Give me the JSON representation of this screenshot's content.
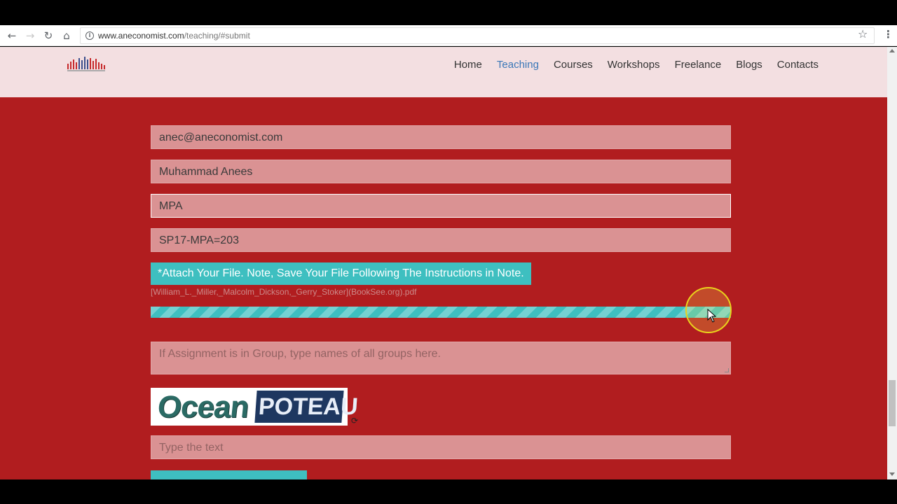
{
  "browser": {
    "url_domain": "www.aneconomist.com",
    "url_path": "/teaching/#submit",
    "back_icon": "back-arrow-icon",
    "forward_icon": "forward-arrow-icon",
    "reload_icon": "reload-icon",
    "home_icon": "home-icon",
    "bookmark_icon": "star-icon",
    "menu_icon": "kebab-menu-icon"
  },
  "header": {
    "nav": [
      "Home",
      "Teaching",
      "Courses",
      "Workshops",
      "Freelance",
      "Blogs",
      "Contacts"
    ],
    "active": "Teaching"
  },
  "form": {
    "email_value": "anec@aneconomist.com",
    "name_value": "Muhammad Anees",
    "program_value": "MPA",
    "roll_value": "SP17-MPA=203",
    "attach_label": "*Attach Your File. Note, Save Your File Following The Instructions in Note.",
    "file_name": "[William_L._Miller,_Malcolm_Dickson,_Gerry_Stoker](BookSee.org).pdf",
    "upload_progress_percent": 100,
    "group_placeholder": "If Assignment is in Group, type names of all groups here.",
    "captcha_word1": "Ocean",
    "captcha_word2": "POTEAU",
    "captcha_placeholder": "Type the text"
  },
  "colors": {
    "page_bg": "#b11d1f",
    "header_bg": "#f3dfe1",
    "accent": "#3ebfc0",
    "nav_active": "#3b78b8"
  }
}
